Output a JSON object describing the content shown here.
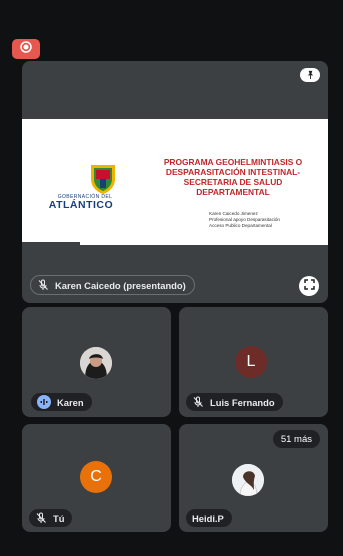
{
  "presentation": {
    "slide_title": "PROGRAMA GEOHELMINTIASIS O DESPARASITACIÓN INTESTINAL- SECRETARIA DE SALUD DEPARTAMENTAL",
    "credits": [
      "Karen Caicedo Jimenez",
      "Profesional apoyo Desparasitación",
      "Acceso Publico Departamental"
    ],
    "logo_small": "GOBERNACIÓN DEL",
    "logo_big": "ATLÁNTICO",
    "presenter_label": "Karen Caicedo (presentando)"
  },
  "participants": [
    {
      "name": "Karen",
      "avatar": "photo",
      "speaking": true
    },
    {
      "name": "Luis Fernando",
      "initial": "L",
      "avatar_color": "#6d2c27",
      "muted": true
    },
    {
      "name": "Tú",
      "initial": "C",
      "avatar_color": "#e8710a",
      "muted": true
    },
    {
      "name": "Heidi.P",
      "avatar": "photo",
      "more_label": "51 más"
    }
  ],
  "colors": {
    "record": "#e5574f",
    "tile": "#3c4043",
    "background": "#101112",
    "speaking": "#8ab4f8"
  },
  "icons": [
    "record-icon",
    "pin-icon",
    "mic-off-icon",
    "fullscreen-icon",
    "audio-level-icon"
  ]
}
